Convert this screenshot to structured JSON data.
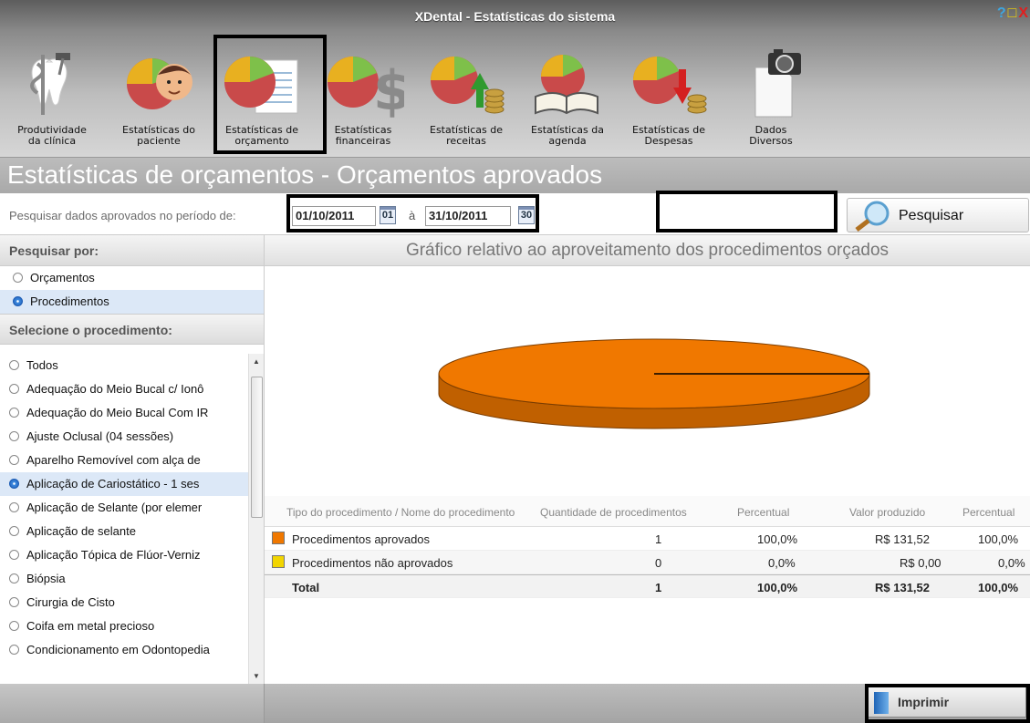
{
  "window": {
    "title": "XDental - Estatísticas do sistema",
    "help": "?",
    "maximize": "□",
    "close": "X"
  },
  "toolbar": [
    {
      "label": "Produtividade\nda clínica",
      "icon": "tooth-caduceus-icon"
    },
    {
      "label": "Estatísticas do\npaciente",
      "icon": "pie-patient-icon"
    },
    {
      "label": "Estatísticas de\norçamento",
      "icon": "pie-budget-icon"
    },
    {
      "label": "Estatísticas\nfinanceiras",
      "icon": "pie-dollar-icon"
    },
    {
      "label": "Estatísticas de\nreceitas",
      "icon": "pie-revenue-icon"
    },
    {
      "label": "Estatísticas da\nagenda",
      "icon": "pie-agenda-icon"
    },
    {
      "label": "Estatísticas de\nDespesas",
      "icon": "pie-expenses-icon"
    },
    {
      "label": "Dados\nDiversos",
      "icon": "camera-document-icon"
    }
  ],
  "page_title": "Estatísticas de orçamentos - Orçamentos aprovados",
  "filter": {
    "label": "Pesquisar dados aprovados no período de:",
    "date_from": "01/10/2011",
    "date_from_cal": "01",
    "separator": "à",
    "date_to": "31/10/2011",
    "date_to_cal": "30",
    "search_button": "Pesquisar"
  },
  "sidebar": {
    "search_by_header": "Pesquisar por:",
    "search_by_options": [
      "Orçamentos",
      "Procedimentos"
    ],
    "selected_search_by": "Procedimentos",
    "procedure_header": "Selecione o procedimento:",
    "procedures": [
      "Todos",
      "Adequação do Meio Bucal c/ Ionô",
      "Adequação do Meio Bucal Com IR",
      "Ajuste Oclusal (04 sessões)",
      "Aparelho Removível com alça de",
      "Aplicação de Cariostático - 1 ses",
      "Aplicação de Selante (por elemer",
      "Aplicação de selante",
      "Aplicação Tópica de Flúor-Verniz",
      "Biópsia",
      "Cirurgia de Cisto",
      "Coifa em metal precioso",
      "Condicionamento em Odontopedia"
    ],
    "selected_procedure": "Aplicação de Cariostático - 1 ses"
  },
  "chart_header": "Gráfico relativo ao aproveitamento dos procedimentos orçados",
  "chart_data": {
    "type": "pie",
    "style": "3d",
    "categories": [
      "Procedimentos aprovados",
      "Procedimentos não aprovados"
    ],
    "values": [
      100.0,
      0.0
    ],
    "colors": [
      "#F07800",
      "#F2D500"
    ]
  },
  "table": {
    "headers": [
      "Tipo do procedimento / Nome do procedimento",
      "Quantidade de procedimentos",
      "Percentual",
      "Valor produzido",
      "Percentual"
    ],
    "rows": [
      {
        "name": "Procedimentos aprovados",
        "color": "#F07800",
        "qty": "1",
        "pct": "100,0%",
        "value": "R$ 131,52",
        "value_pct": "100,0%"
      },
      {
        "name": "Procedimentos não aprovados",
        "color": "#F2D500",
        "qty": "0",
        "pct": "0,0%",
        "value": "R$ 0,00",
        "value_pct": "0,0%"
      }
    ],
    "total": {
      "name": "Total",
      "qty": "1",
      "pct": "100,0%",
      "value": "R$ 131,52",
      "value_pct": "100,0%"
    }
  },
  "print_button": "Imprimir"
}
